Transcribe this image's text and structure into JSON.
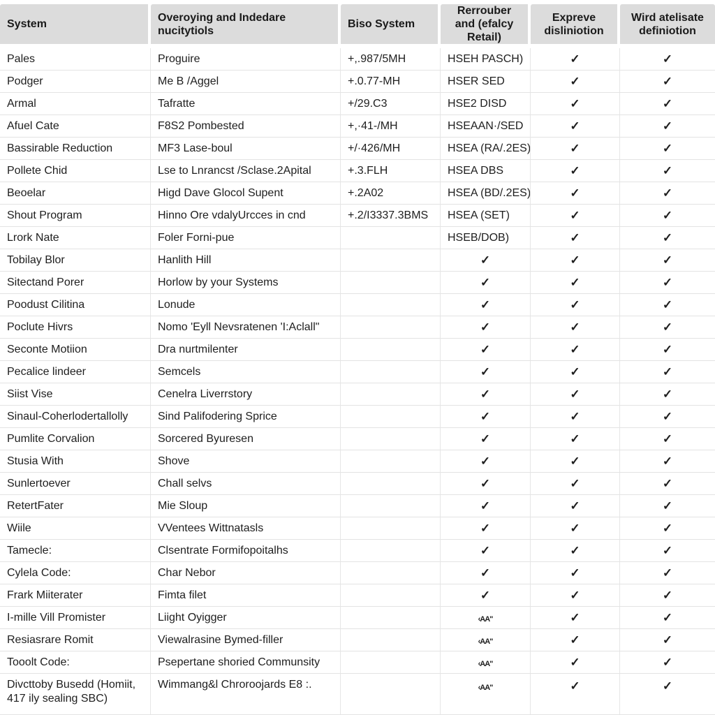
{
  "table": {
    "headers": [
      "System",
      "Overoying and Indedare nucitytiols",
      "Biso System",
      "Rerrouber and (efalcy Retail)",
      "Expreve disliniotion",
      "Wird atelisate definiotion"
    ],
    "check_glyph": "✓",
    "rows": [
      {
        "system": "Pales",
        "desc": "Proguire",
        "biso": "+,.987/5MH",
        "retail": "HSEH PASCH)",
        "expreve": "✓",
        "wird": "✓"
      },
      {
        "system": "Podger",
        "desc": "Me B /Aggel",
        "biso": "+.0.77-MH",
        "retail": "HSER SED",
        "expreve": "✓",
        "wird": "✓"
      },
      {
        "system": "Armal",
        "desc": "Tafratte",
        "biso": "+/29.C3",
        "retail": "HSE2 DISD",
        "expreve": "✓",
        "wird": "✓"
      },
      {
        "system": "Afuel Cate",
        "desc": "F8S2 Pombested",
        "biso": "+,·41-/MH",
        "retail": "HSEAAN·/SED",
        "expreve": "✓",
        "wird": "✓"
      },
      {
        "system": "Bassirable Reduction",
        "desc": "MF3 Lase-boul",
        "biso": "+/·426/MH",
        "retail": "HSEA (RA/.2ES)",
        "expreve": "✓",
        "wird": "✓"
      },
      {
        "system": "Pollete Chid",
        "desc": "Lse to Lnrancst /Sclase.2Apital",
        "biso": "+.3.FLH",
        "retail": "HSEA DBS",
        "expreve": "✓",
        "wird": "✓"
      },
      {
        "system": "Beoelar",
        "desc": "Higd Dave Glocol Supent",
        "biso": "+.2A02",
        "retail": "HSEA (BD/.2ES)",
        "expreve": "✓",
        "wird": "✓"
      },
      {
        "system": "Shout Program",
        "desc": "Hinno Ore vdalyUrcces in cnd",
        "biso": "+.2/I3337.3BMS",
        "retail": "HSEA (SET)",
        "expreve": "✓",
        "wird": "✓"
      },
      {
        "system": "Lrork Nate",
        "desc": "Foler Forni-pue",
        "biso": "",
        "retail": "HSEB/DOB)",
        "expreve": "✓",
        "wird": "✓"
      },
      {
        "system": "Tobilay Blor",
        "desc": "Hanlith Hill",
        "biso": "",
        "retail": "✓",
        "expreve": "✓",
        "wird": "✓"
      },
      {
        "system": "Sitectand Porer",
        "desc": "Horlow by your Systems",
        "biso": "",
        "retail": "✓",
        "expreve": "✓",
        "wird": "✓"
      },
      {
        "system": "Poodust Cilitina",
        "desc": "Lonude",
        "biso": "",
        "retail": "✓",
        "expreve": "✓",
        "wird": "✓"
      },
      {
        "system": "Poclute Hivrs",
        "desc": "Nomo 'Eyll Nevsratenen 'I:Aclall\"",
        "biso": "",
        "retail": "✓",
        "expreve": "✓",
        "wird": "✓"
      },
      {
        "system": "Seconte Motiion",
        "desc": "Dra nurtmilenter",
        "biso": "",
        "retail": "✓",
        "expreve": "✓",
        "wird": "✓"
      },
      {
        "system": "Pecalice lindeer",
        "desc": "Semcels",
        "biso": "",
        "retail": "✓",
        "expreve": "✓",
        "wird": "✓"
      },
      {
        "system": "Siist Vise",
        "desc": "Cenelra Liverrstory",
        "biso": "",
        "retail": "✓",
        "expreve": "✓",
        "wird": "✓"
      },
      {
        "system": "Sinaul-Coherlodertallolly",
        "desc": "Sind Palifodering Sprice",
        "biso": "",
        "retail": "✓",
        "expreve": "✓",
        "wird": "✓"
      },
      {
        "system": "Pumlite Corvalion",
        "desc": "Sorcered Byuresen",
        "biso": "",
        "retail": "✓",
        "expreve": "✓",
        "wird": "✓"
      },
      {
        "system": "Stusia With",
        "desc": "Shove",
        "biso": "",
        "retail": "✓",
        "expreve": "✓",
        "wird": "✓"
      },
      {
        "system": "Sunlertoever",
        "desc": "Chall selvs",
        "biso": "",
        "retail": "✓",
        "expreve": "✓",
        "wird": "✓"
      },
      {
        "system": "RetertFater",
        "desc": "Mie Sloup",
        "biso": "",
        "retail": "✓",
        "expreve": "✓",
        "wird": "✓"
      },
      {
        "system": "Wiile",
        "desc": "VVentees Wittnatasls",
        "biso": "",
        "retail": "✓",
        "expreve": "✓",
        "wird": "✓"
      },
      {
        "system": "Tamecle:",
        "desc": "Clsentrate Formifopoitalhs",
        "biso": "",
        "retail": "✓",
        "expreve": "✓",
        "wird": "✓"
      },
      {
        "system": "Cylela Code:",
        "desc": "Char Nebor",
        "biso": "",
        "retail": "✓",
        "expreve": "✓",
        "wird": "✓"
      },
      {
        "system": "Frark Miiterater",
        "desc": "Fimta filet",
        "biso": "",
        "retail": "✓",
        "expreve": "✓",
        "wird": "✓"
      },
      {
        "system": "I-mille Vill Promister",
        "desc": "Liight Oyigger",
        "biso": "",
        "retail": "‹AA\"",
        "expreve": "✓",
        "wird": "✓"
      },
      {
        "system": "Resiasrare Romit",
        "desc": "Viewalrasine Bymed-filler",
        "biso": "",
        "retail": "‹AA\"",
        "expreve": "✓",
        "wird": "✓"
      },
      {
        "system": "Tooolt Code:",
        "desc": "Psepertane shoried Communsity",
        "biso": "",
        "retail": "‹AA\"",
        "expreve": "✓",
        "wird": "✓"
      },
      {
        "system": "Divcttoby Busedd (Homiit, 417 ily sealing SBC)",
        "desc": "Wimmang&l Chroroojards E8 :.",
        "biso": "",
        "retail": "‹AA\"",
        "expreve": "✓",
        "wird": "✓"
      }
    ]
  }
}
